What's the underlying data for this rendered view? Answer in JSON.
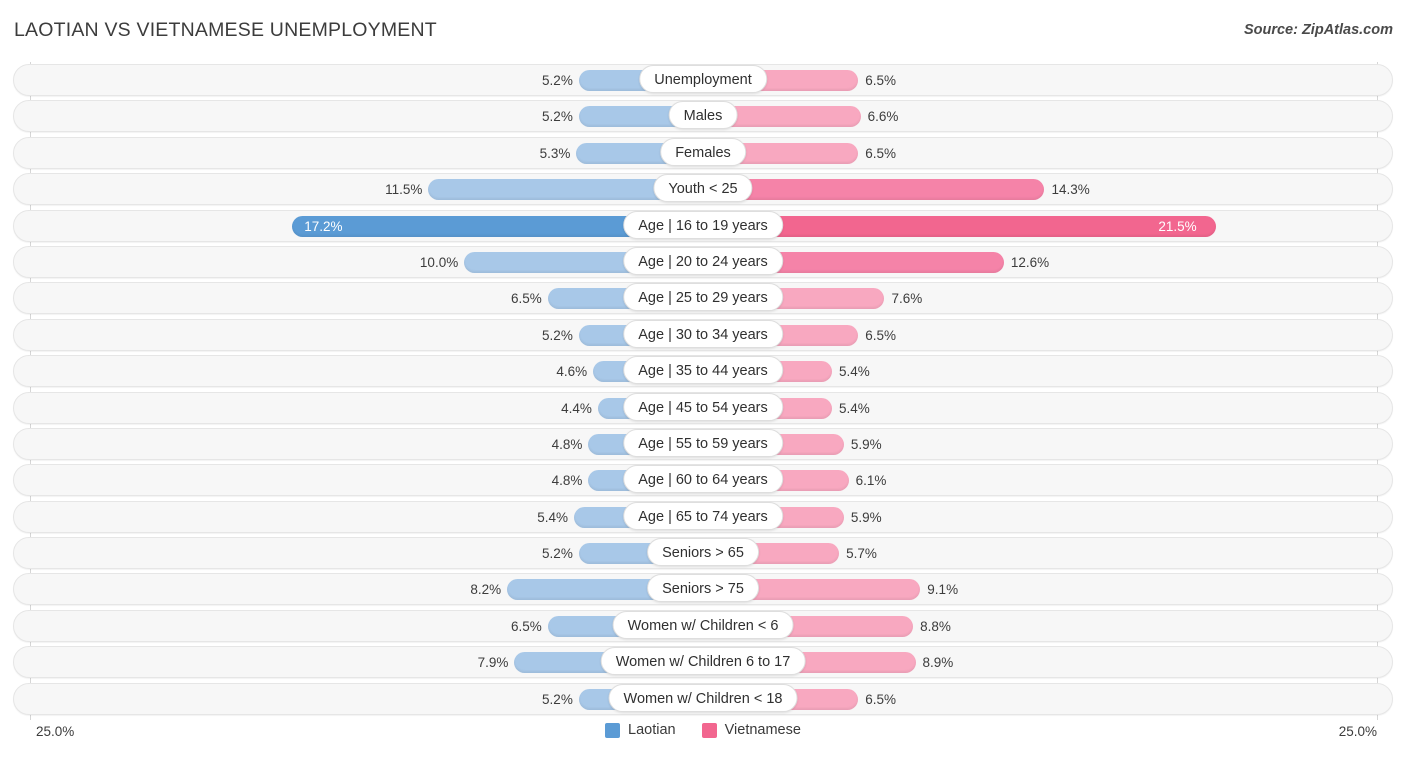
{
  "header": {
    "title": "LAOTIAN VS VIETNAMESE UNEMPLOYMENT",
    "source": "Source: ZipAtlas.com"
  },
  "axis": {
    "left_label": "25.0%",
    "right_label": "25.0%",
    "max": 25.0
  },
  "legend": {
    "items": [
      {
        "label": "Laotian",
        "color": "#5b9bd5"
      },
      {
        "label": "Vietnamese",
        "color": "#f2668f"
      }
    ]
  },
  "colors": {
    "left_light": "#a8c8e8",
    "left_mid": "#85b3e0",
    "left_dark": "#5b9bd5",
    "right_light": "#f8a8c0",
    "right_mid": "#f583a8",
    "right_dark": "#f2668f",
    "track_bg": "#f7f7f7",
    "track_border": "#e6e6e6",
    "gridline": "#d6d6d6"
  },
  "chart_data": {
    "type": "bar",
    "title": "LAOTIAN VS VIETNAMESE UNEMPLOYMENT",
    "subtitle": "",
    "xlabel": "",
    "ylabel": "",
    "orientation": "horizontal-diverging",
    "xlim": [
      25.0,
      25.0
    ],
    "grid": true,
    "legend_position": "bottom-center",
    "categories": [
      "Unemployment",
      "Males",
      "Females",
      "Youth < 25",
      "Age | 16 to 19 years",
      "Age | 20 to 24 years",
      "Age | 25 to 29 years",
      "Age | 30 to 34 years",
      "Age | 35 to 44 years",
      "Age | 45 to 54 years",
      "Age | 55 to 59 years",
      "Age | 60 to 64 years",
      "Age | 65 to 74 years",
      "Seniors > 65",
      "Seniors > 75",
      "Women w/ Children < 6",
      "Women w/ Children 6 to 17",
      "Women w/ Children < 18"
    ],
    "series": [
      {
        "name": "Laotian",
        "values": [
          5.2,
          5.2,
          5.3,
          11.5,
          17.2,
          10.0,
          6.5,
          5.2,
          4.6,
          4.4,
          4.8,
          4.8,
          5.4,
          5.2,
          8.2,
          6.5,
          7.9,
          5.2
        ],
        "labels": [
          "5.2%",
          "5.2%",
          "5.3%",
          "11.5%",
          "17.2%",
          "10.0%",
          "6.5%",
          "5.2%",
          "4.6%",
          "4.4%",
          "4.8%",
          "4.8%",
          "5.4%",
          "5.2%",
          "8.2%",
          "6.5%",
          "7.9%",
          "5.2%"
        ]
      },
      {
        "name": "Vietnamese",
        "values": [
          6.5,
          6.6,
          6.5,
          14.3,
          21.5,
          12.6,
          7.6,
          6.5,
          5.4,
          5.4,
          5.9,
          6.1,
          5.9,
          5.7,
          9.1,
          8.8,
          8.9,
          6.5
        ],
        "labels": [
          "6.5%",
          "6.6%",
          "6.5%",
          "14.3%",
          "21.5%",
          "12.6%",
          "7.6%",
          "6.5%",
          "5.4%",
          "5.4%",
          "5.9%",
          "6.1%",
          "5.9%",
          "5.7%",
          "9.1%",
          "8.8%",
          "8.9%",
          "6.5%"
        ]
      }
    ],
    "highlight_index": 4
  }
}
